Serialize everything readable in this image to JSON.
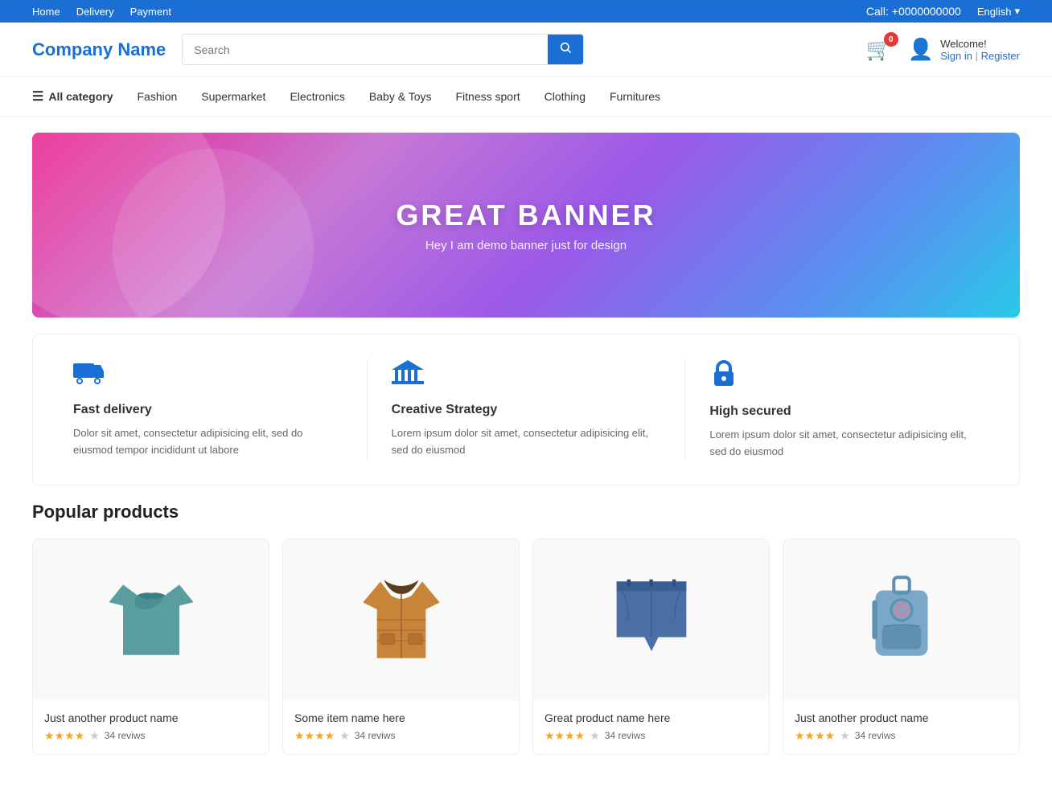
{
  "topbar": {
    "nav_links": [
      "Home",
      "Delivery",
      "Payment"
    ],
    "phone_label": "Call: +0000000000",
    "language": "English",
    "language_arrow": "▾"
  },
  "header": {
    "logo": "Company Name",
    "search_placeholder": "Search",
    "cart_count": "0",
    "welcome_text": "Welcome!",
    "sign_in": "Sign in",
    "separator": "|",
    "register": "Register"
  },
  "nav": {
    "hamburger": "☰",
    "all_category": "All category",
    "items": [
      "Fashion",
      "Supermarket",
      "Electronics",
      "Baby &amp; Toys",
      "Fitness sport",
      "Clothing",
      "Furnitures"
    ]
  },
  "banner": {
    "title": "GREAT BANNER",
    "subtitle": "Hey I am demo banner just for design"
  },
  "features": [
    {
      "icon": "truck",
      "title": "Fast delivery",
      "description": "Dolor sit amet, consectetur adipisicing elit, sed do eiusmod tempor incididunt ut labore"
    },
    {
      "icon": "bank",
      "title": "Creative Strategy",
      "description": "Lorem ipsum dolor sit amet, consectetur adipisicing elit, sed do eiusmod"
    },
    {
      "icon": "lock",
      "title": "High secured",
      "description": "Lorem ipsum dolor sit amet, consectetur adipisicing elit, sed do eiusmod"
    }
  ],
  "popular_products": {
    "section_title": "Popular products",
    "products": [
      {
        "id": 1,
        "name": "Just another product name",
        "stars_filled": 4,
        "stars_empty": 1,
        "reviews": "34 reviws",
        "color": "teal-shirt"
      },
      {
        "id": 2,
        "name": "Some item name here",
        "stars_filled": 4,
        "stars_empty": 1,
        "reviews": "34 reviws",
        "color": "brown-jacket"
      },
      {
        "id": 3,
        "name": "Great product name here",
        "stars_filled": 4,
        "stars_empty": 1,
        "reviews": "34 reviws",
        "color": "blue-shorts"
      },
      {
        "id": 4,
        "name": "Just another product name",
        "stars_filled": 4,
        "stars_empty": 1,
        "reviews": "34 reviws",
        "color": "blue-backpack"
      }
    ]
  }
}
